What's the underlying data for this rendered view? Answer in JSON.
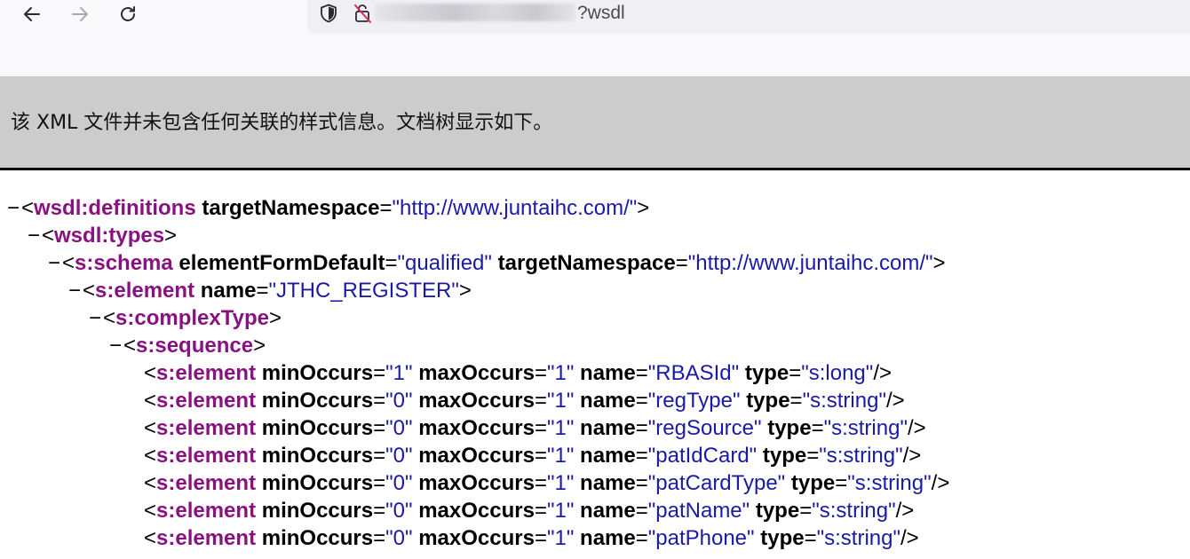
{
  "browser": {
    "url_suffix": "?wsdl"
  },
  "banner": {
    "message": "该 XML 文件并未包含任何关联的样式信息。文档树显示如下。"
  },
  "colors": {
    "tag": "#881280",
    "attr_value": "#1a1aa6",
    "banner_bg": "#cccccc"
  },
  "xml": {
    "collapse_glyph": "−",
    "lines": [
      {
        "depth": 0,
        "collapsible": true,
        "open": "<",
        "tag": "wsdl:definitions",
        "attrs": [
          {
            "name": "targetNamespace",
            "value": "http://www.juntaihc.com/"
          }
        ],
        "close": ">"
      },
      {
        "depth": 1,
        "collapsible": true,
        "open": "<",
        "tag": "wsdl:types",
        "attrs": [],
        "close": ">"
      },
      {
        "depth": 2,
        "collapsible": true,
        "open": "<",
        "tag": "s:schema",
        "attrs": [
          {
            "name": "elementFormDefault",
            "value": "qualified"
          },
          {
            "name": "targetNamespace",
            "value": "http://www.juntaihc.com/"
          }
        ],
        "close": ">"
      },
      {
        "depth": 3,
        "collapsible": true,
        "open": "<",
        "tag": "s:element",
        "attrs": [
          {
            "name": "name",
            "value": "JTHC_REGISTER"
          }
        ],
        "close": ">"
      },
      {
        "depth": 4,
        "collapsible": true,
        "open": "<",
        "tag": "s:complexType",
        "attrs": [],
        "close": ">"
      },
      {
        "depth": 5,
        "collapsible": true,
        "open": "<",
        "tag": "s:sequence",
        "attrs": [],
        "close": ">"
      },
      {
        "depth": 6,
        "collapsible": false,
        "open": "<",
        "tag": "s:element",
        "attrs": [
          {
            "name": "minOccurs",
            "value": "1"
          },
          {
            "name": "maxOccurs",
            "value": "1"
          },
          {
            "name": "name",
            "value": "RBASId"
          },
          {
            "name": "type",
            "value": "s:long"
          }
        ],
        "close": "/>"
      },
      {
        "depth": 6,
        "collapsible": false,
        "open": "<",
        "tag": "s:element",
        "attrs": [
          {
            "name": "minOccurs",
            "value": "0"
          },
          {
            "name": "maxOccurs",
            "value": "1"
          },
          {
            "name": "name",
            "value": "regType"
          },
          {
            "name": "type",
            "value": "s:string"
          }
        ],
        "close": "/>"
      },
      {
        "depth": 6,
        "collapsible": false,
        "open": "<",
        "tag": "s:element",
        "attrs": [
          {
            "name": "minOccurs",
            "value": "0"
          },
          {
            "name": "maxOccurs",
            "value": "1"
          },
          {
            "name": "name",
            "value": "regSource"
          },
          {
            "name": "type",
            "value": "s:string"
          }
        ],
        "close": "/>"
      },
      {
        "depth": 6,
        "collapsible": false,
        "open": "<",
        "tag": "s:element",
        "attrs": [
          {
            "name": "minOccurs",
            "value": "0"
          },
          {
            "name": "maxOccurs",
            "value": "1"
          },
          {
            "name": "name",
            "value": "patIdCard"
          },
          {
            "name": "type",
            "value": "s:string"
          }
        ],
        "close": "/>"
      },
      {
        "depth": 6,
        "collapsible": false,
        "open": "<",
        "tag": "s:element",
        "attrs": [
          {
            "name": "minOccurs",
            "value": "0"
          },
          {
            "name": "maxOccurs",
            "value": "1"
          },
          {
            "name": "name",
            "value": "patCardType"
          },
          {
            "name": "type",
            "value": "s:string"
          }
        ],
        "close": "/>"
      },
      {
        "depth": 6,
        "collapsible": false,
        "open": "<",
        "tag": "s:element",
        "attrs": [
          {
            "name": "minOccurs",
            "value": "0"
          },
          {
            "name": "maxOccurs",
            "value": "1"
          },
          {
            "name": "name",
            "value": "patName"
          },
          {
            "name": "type",
            "value": "s:string"
          }
        ],
        "close": "/>"
      },
      {
        "depth": 6,
        "collapsible": false,
        "open": "<",
        "tag": "s:element",
        "attrs": [
          {
            "name": "minOccurs",
            "value": "0"
          },
          {
            "name": "maxOccurs",
            "value": "1"
          },
          {
            "name": "name",
            "value": "patPhone"
          },
          {
            "name": "type",
            "value": "s:string"
          }
        ],
        "close": "/>"
      }
    ]
  }
}
